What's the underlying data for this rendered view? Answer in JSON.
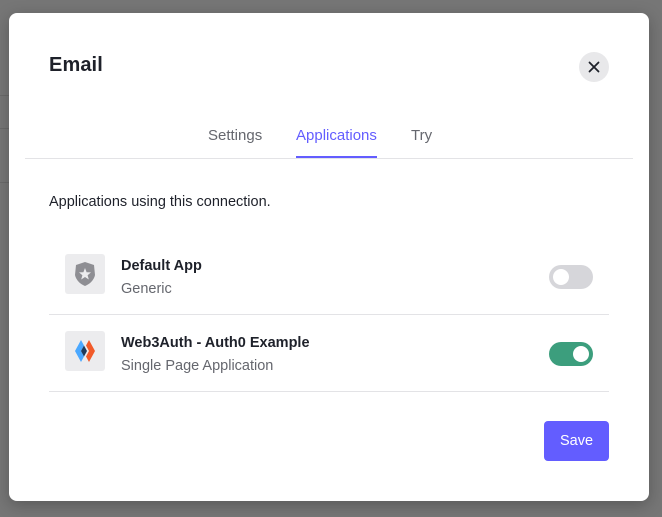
{
  "modal": {
    "title": "Email",
    "close_icon": "close-icon"
  },
  "tabs": [
    {
      "label": "Settings",
      "active": false
    },
    {
      "label": "Applications",
      "active": true
    },
    {
      "label": "Try",
      "active": false
    }
  ],
  "intro_text": "Applications using this connection.",
  "applications": [
    {
      "name": "Default App",
      "type": "Generic",
      "icon": "auth0-shield-icon",
      "enabled": false
    },
    {
      "name": "Web3Auth - Auth0 Example",
      "type": "Single Page Application",
      "icon": "web3auth-logo-icon",
      "enabled": true
    }
  ],
  "footer": {
    "save_label": "Save"
  },
  "colors": {
    "accent": "#635dff",
    "toggle_on": "#3c9e7d",
    "toggle_off": "#d6d6da"
  }
}
